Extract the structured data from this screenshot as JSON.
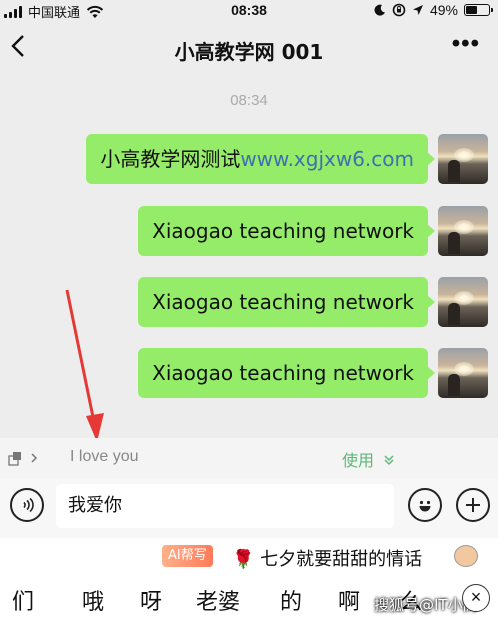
{
  "status_bar": {
    "carrier": "中国联通",
    "time": "08:38",
    "battery": "49%",
    "battery_level": 0.49,
    "icons": [
      "signal-icon",
      "wifi-icon",
      "moon-icon",
      "rotation-lock-icon",
      "location-icon",
      "battery-icon"
    ]
  },
  "nav": {
    "title": "小高教学网 001",
    "back_icon": "chevron-left-icon",
    "more": "•••"
  },
  "chat": {
    "timestamp": "08:34",
    "messages": [
      {
        "text_cn": "小高教学网测试",
        "text_link": "www.xgjxw6.com"
      },
      {
        "text": "Xiaogao teaching network"
      },
      {
        "text": "Xiaogao teaching network"
      },
      {
        "text": "Xiaogao teaching network"
      }
    ]
  },
  "suggestion": {
    "icon": "translate-icon",
    "chevron": "›",
    "text": "I love you",
    "use_label": "使用"
  },
  "input": {
    "value": "我爱你"
  },
  "ime": {
    "ai_label": "AI帮写",
    "suggest_prefix": "🌹",
    "suggest_text": "七夕就要甜甜的情话",
    "candidates": [
      "们",
      "哦",
      "呀",
      "老婆",
      "的",
      "啊",
      "么"
    ],
    "watermark": "搜狐号@IT小高",
    "close": "×"
  },
  "colors": {
    "bubble": "#95ec69",
    "link": "#3f6fb1",
    "use": "#5fb878",
    "arrow": "#e53935"
  }
}
